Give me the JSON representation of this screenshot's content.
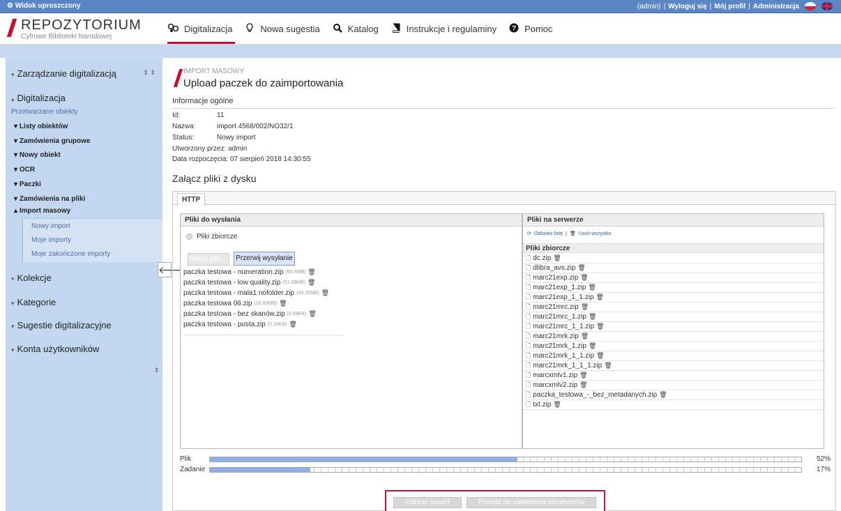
{
  "topbar": {
    "view_label": "Widok uproszczony",
    "user": "(admin)",
    "logout": "Wyloguj się",
    "profile": "Mój profil",
    "admin": "Administracja",
    "sep": "|"
  },
  "logo": {
    "name": "REPOZYTORIUM",
    "subtitle": "Cyfrowe Biblioteki Narodowej"
  },
  "nav": [
    {
      "label": "Digitalizacja",
      "icon": "digitization-icon"
    },
    {
      "label": "Nowa sugestia",
      "icon": "lightbulb-icon"
    },
    {
      "label": "Katalog",
      "icon": "search-icon"
    },
    {
      "label": "Instrukcje i regulaminy",
      "icon": "book-icon"
    },
    {
      "label": "Pomoc",
      "icon": "help-icon"
    }
  ],
  "sidebar": {
    "digit_mgmt": "Zarządzanie digitalizacją",
    "digitalizacja": "Digitalizacja",
    "processed": "Przetwarzane obiekty",
    "items": [
      "Listy obiektów",
      "Zamówienia grupowe",
      "Nowy obiekt",
      "OCR",
      "Paczki",
      "Zamówienia na pliki",
      "Import masowy"
    ],
    "imports": [
      "Nowy import",
      "Moje importy",
      "Moje zakończone importy"
    ],
    "groups": [
      "Kolekcje",
      "Kategorie",
      "Sugestie digitalizacyjne",
      "Konta użytkowników"
    ]
  },
  "page": {
    "breadcrumb": "IMPORT MASOWY",
    "title": "Upload paczek do zaimportowania",
    "info_title": "Informacje ogólne",
    "info": [
      {
        "label": "Id:",
        "value": "11"
      },
      {
        "label": "Nazwa:",
        "value": "import 4568/002/NO32/1"
      },
      {
        "label": "Status:",
        "value": "Nowy import"
      },
      {
        "label": "Utworzony przez:",
        "value": "admin"
      },
      {
        "label": "Data rozpoczęcia:",
        "value": "07 sierpień 2018 14:30:55"
      }
    ],
    "attach_title": "Załącz pliki z dysku",
    "tab": "HTTP"
  },
  "upload": {
    "header": "Pliki do wysłania",
    "radio": "Pliki zbiorcze",
    "add_btn": "Dodaj pliki...",
    "stop_btn": "Przerwij wysyłanie",
    "files": [
      {
        "name": "paczka testowa - numeration.zip",
        "size": "(60.4MB)"
      },
      {
        "name": "paczka testowa - low quality.zip",
        "size": "(51.08MB)"
      },
      {
        "name": "paczka testowa - mala1 nofolder.zip",
        "size": "(44.35MB)"
      },
      {
        "name": "paczka testowa 06.zip",
        "size": "(28.83MB)"
      },
      {
        "name": "paczka testowa - bez skanów.zip",
        "size": "(0.88KB)"
      },
      {
        "name": "paczka testowa - pusta.zip",
        "size": "(0.16KB)"
      }
    ]
  },
  "server": {
    "header": "Pliki na serwerze",
    "refresh": "Odśwież listę",
    "delete_all": "Usuń wszystko",
    "sep": "|",
    "sub_header": "Pliki zbiorcze",
    "files": [
      "dc.zip",
      "dlibra_avs.zip",
      "marc21exp.zip",
      "marc21exp_1.zip",
      "marc21exp_1_1.zip",
      "marc21mrc.zip",
      "marc21mrc_1.zip",
      "marc21mrc_1_1.zip",
      "marc21mrk.zip",
      "marc21mrk_1.zip",
      "marc21mrk_1_1.zip",
      "marc21mrk_1_1_1.zip",
      "marcxmlv1.zip",
      "marcxmlv2.zip",
      "paczka_testowa_-_bez_metadanych.zip",
      "txt.zip"
    ]
  },
  "progress": [
    {
      "label": "Plik",
      "value": 52,
      "text": "52%"
    },
    {
      "label": "Zadanie",
      "value": 17,
      "text": "17%"
    }
  ],
  "actions": {
    "reject": "Odrzuć (usuń) import",
    "next": "Przejdź do ustawienia parametrów importu"
  }
}
